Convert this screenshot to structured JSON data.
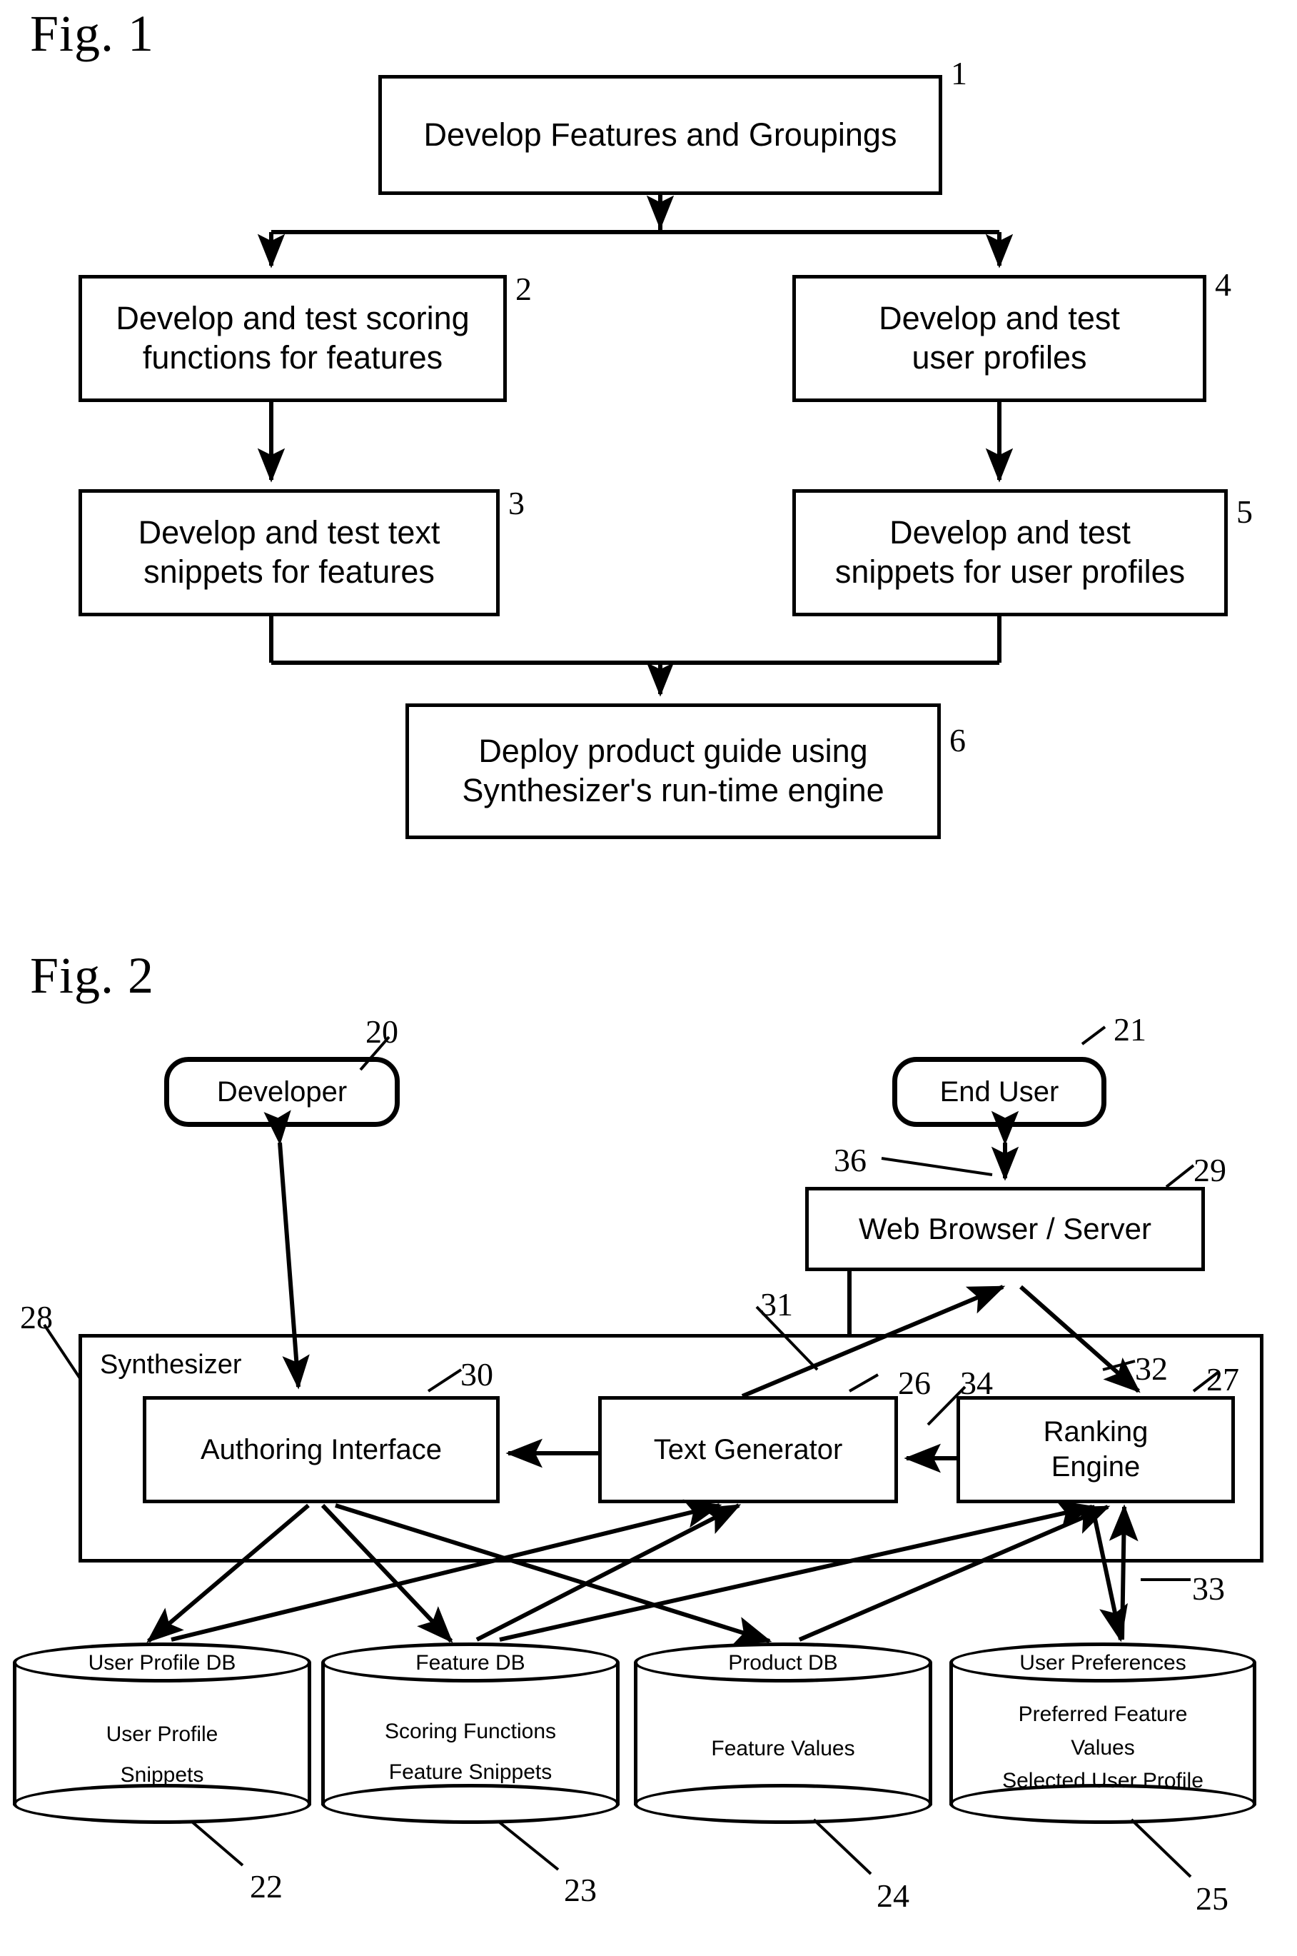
{
  "figures": [
    {
      "title": "Fig. 1",
      "nodes": [
        {
          "ref": "1",
          "label": "Develop Features and Groupings"
        },
        {
          "ref": "2",
          "label": "Develop and test scoring\nfunctions for features"
        },
        {
          "ref": "3",
          "label": "Develop and test text\nsnippets for features"
        },
        {
          "ref": "4",
          "label": "Develop and test\nuser profiles"
        },
        {
          "ref": "5",
          "label": "Develop and test\nsnippets for user profiles"
        },
        {
          "ref": "6",
          "label": "Deploy product guide using\nSynthesizer's run-time engine"
        }
      ]
    },
    {
      "title": "Fig. 2",
      "actors": [
        {
          "ref": "20",
          "label": "Developer"
        },
        {
          "ref": "21",
          "label": "End User"
        }
      ],
      "components": [
        {
          "ref": "29",
          "label": "Web Browser / Server"
        },
        {
          "ref": "28",
          "label": "Synthesizer"
        },
        {
          "ref": "30",
          "label": "Authoring Interface"
        },
        {
          "ref": "26",
          "label": "Text Generator"
        },
        {
          "ref": "27",
          "label": "Ranking\nEngine"
        }
      ],
      "link_refs": [
        {
          "ref": "36"
        },
        {
          "ref": "31"
        },
        {
          "ref": "32"
        },
        {
          "ref": "34"
        },
        {
          "ref": "33"
        }
      ],
      "databases": [
        {
          "ref": "22",
          "title": "User Profile DB",
          "lines": [
            "User Profile",
            "Snippets"
          ]
        },
        {
          "ref": "23",
          "title": "Feature DB",
          "lines": [
            "Scoring Functions",
            "Feature Snippets"
          ]
        },
        {
          "ref": "24",
          "title": "Product DB",
          "lines": [
            "Feature Values"
          ]
        },
        {
          "ref": "25",
          "title": "User Preferences",
          "lines": [
            "Preferred Feature",
            "Values",
            "Selected User Profile"
          ]
        }
      ]
    }
  ],
  "colors": {
    "ink": "#000000",
    "paper": "#ffffff"
  }
}
